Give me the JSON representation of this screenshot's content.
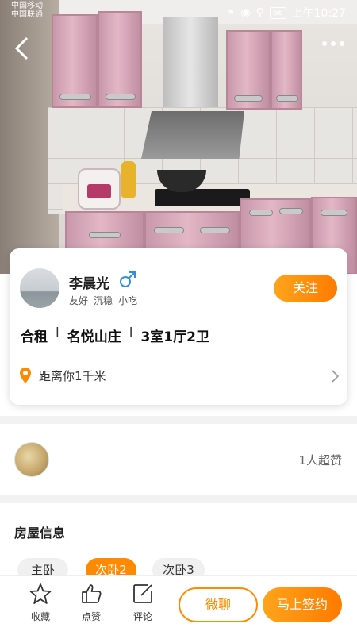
{
  "status_bar": {
    "carrier1": "中国移动",
    "carrier2": "中国联通",
    "battery": "66",
    "time": "上午10:27"
  },
  "profile": {
    "name": "李晨光",
    "gender_icon": "male-symbol-icon",
    "tags": [
      "友好",
      "沉稳",
      "小吃"
    ],
    "follow_label": "关注"
  },
  "house": {
    "type": "合租",
    "community": "名悦山庄",
    "layout": "3室1厅2卫",
    "separator": "l"
  },
  "location": {
    "distance_text": "距离你1千米"
  },
  "likes": {
    "count_text": "1人超赞"
  },
  "house_info": {
    "title": "房屋信息",
    "rooms": [
      {
        "label": "主卧",
        "active": false
      },
      {
        "label": "次卧2",
        "active": true
      },
      {
        "label": "次卧3",
        "active": false
      }
    ]
  },
  "bottom_bar": {
    "favorite_label": "收藏",
    "like_label": "点赞",
    "comment_label": "评论",
    "chat_label": "微聊",
    "sign_label": "马上签约"
  },
  "colors": {
    "accent": "#ff8a00",
    "male_icon": "#2f8fd9"
  }
}
